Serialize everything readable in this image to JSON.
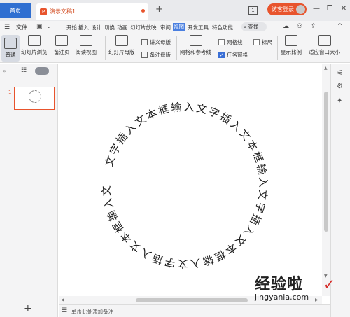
{
  "titlebar": {
    "home_tab": "首页",
    "doc_tab": "演示文稿1",
    "logo_glyph": "P",
    "new_tab": "+",
    "page_indicator": "1",
    "login_button": "访客登录",
    "accent": "#e8542d",
    "brand_blue": "#2f6fd1"
  },
  "ribbon": {
    "file_label": "文件",
    "tabs": [
      "开始",
      "插入",
      "设计",
      "切换",
      "动画",
      "幻灯片放映",
      "审阅",
      "视图",
      "开发工具",
      "特色功能"
    ],
    "active_tab": "视图",
    "search_label": "查找"
  },
  "toolbar": {
    "normal": "普通",
    "slide_browse": "幻灯片浏览",
    "notes_page": "备注页",
    "reading_view": "阅读视图",
    "slide_master": "幻灯片母版",
    "handout_master": "讲义母版",
    "notes_master": "备注母版",
    "grid_guides": "网格和参考线",
    "gridlines": "网格线",
    "ruler": "标尺",
    "task_pane": "任务窗格",
    "show_ratio": "显示比例",
    "fit_window": "适应窗口大小"
  },
  "left_panel": {
    "slide_number": "1",
    "add_slide": "+"
  },
  "slide": {
    "circle_text": "文字插入文本框输入文字插入文本框输入文字插入文本框输入文字插入文本框输入文"
  },
  "notes": {
    "placeholder": "单击此处添加备注"
  },
  "watermark": {
    "title": "经验啦",
    "url": "jingyanla.com"
  }
}
